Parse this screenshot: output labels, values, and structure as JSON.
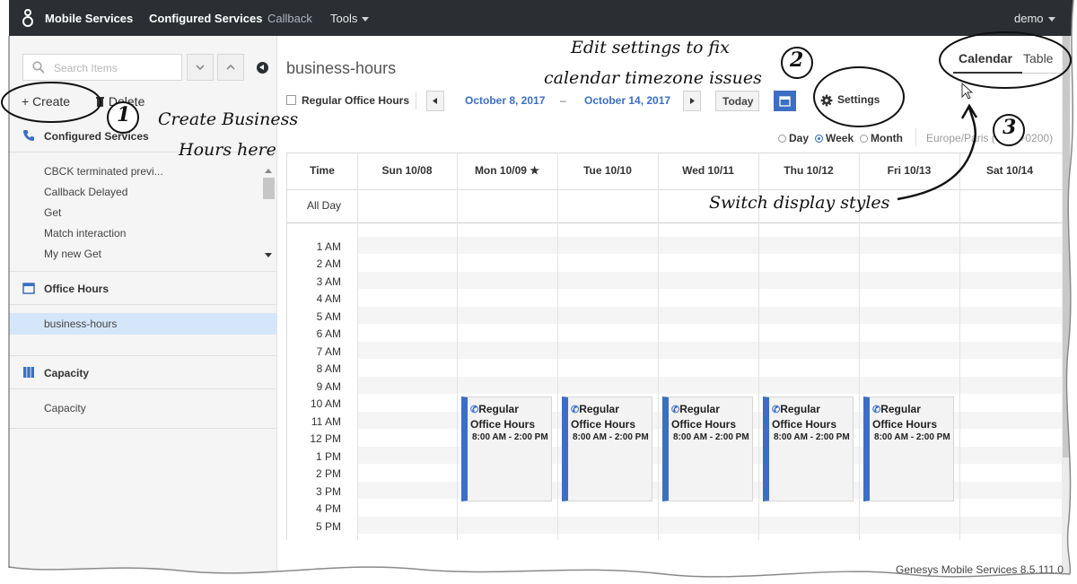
{
  "topbar": {
    "app_title": "Mobile Services",
    "nav": [
      "Configured Services",
      "Callback",
      "Tools"
    ],
    "user": "demo"
  },
  "sidebar": {
    "search_placeholder": "Search Items",
    "create_label": "+ Create",
    "delete_label": "Delete",
    "sections": [
      {
        "title": "Configured Services",
        "icon": "phone-icon",
        "items": [
          "CBCK terminated previ...",
          "Callback Delayed",
          "Get",
          "Match interaction",
          "My new Get"
        ]
      },
      {
        "title": "Office Hours",
        "icon": "calendar-icon",
        "items": [
          "business-hours"
        ]
      },
      {
        "title": "Capacity",
        "icon": "columns-icon",
        "items": [
          "Capacity"
        ]
      }
    ]
  },
  "main": {
    "title": "business-hours",
    "view_toggle": {
      "calendar": "Calendar",
      "table": "Table",
      "selected": "Calendar"
    },
    "toolbar": {
      "checkbox_label": "Regular Office Hours",
      "date_from": "October 8, 2017",
      "date_sep": "–",
      "date_to": "October 14, 2017",
      "today_label": "Today",
      "settings_label": "Settings"
    },
    "view_modes": {
      "day": "Day",
      "week": "Week",
      "month": "Month",
      "selected": "Week"
    },
    "timezone": "Europe/Paris (GMT+0200)",
    "calendar": {
      "time_header": "Time",
      "all_day_label": "All Day",
      "days": [
        "Sun 10/08",
        "Mon 10/09 ★",
        "Tue 10/10",
        "Wed 10/11",
        "Thu 10/12",
        "Fri 10/13",
        "Sat 10/14"
      ],
      "hours": [
        "1 AM",
        "2 AM",
        "3 AM",
        "4 AM",
        "5 AM",
        "6 AM",
        "7 AM",
        "8 AM",
        "9 AM",
        "10 AM",
        "11 AM",
        "12 PM",
        "1 PM",
        "2 PM",
        "3 PM",
        "4 PM",
        "5 PM"
      ],
      "event_title": "Regular Office Hours",
      "event_time": "8:00 AM - 2:00 PM"
    }
  },
  "footer": "Genesys Mobile Services 8.5.111.0",
  "annotations": {
    "step1": "1",
    "step1_text_a": "Create Business",
    "step1_text_b": "Hours here",
    "step2": "2",
    "step2_text_a": "Edit settings to fix",
    "step2_text_b": "calendar timezone issues",
    "step3": "3",
    "step3_text": "Switch display styles"
  }
}
